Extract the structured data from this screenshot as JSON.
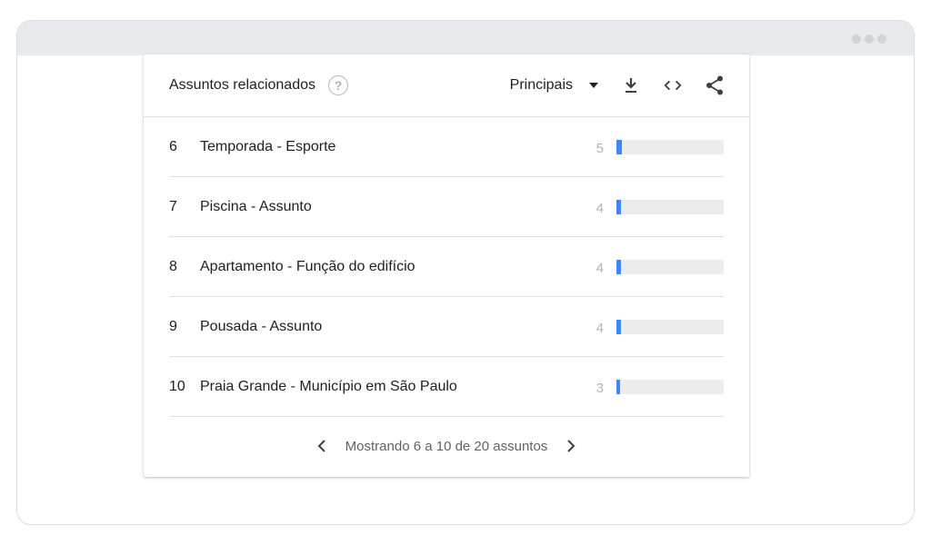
{
  "widget": {
    "title": "Assuntos relacionados",
    "sort_label": "Principais"
  },
  "rows": [
    {
      "rank": "6",
      "label": "Temporada - Esporte",
      "value": "5",
      "fraction": 0.05
    },
    {
      "rank": "7",
      "label": "Piscina - Assunto",
      "value": "4",
      "fraction": 0.04
    },
    {
      "rank": "8",
      "label": "Apartamento - Função do edifício",
      "value": "4",
      "fraction": 0.04
    },
    {
      "rank": "9",
      "label": "Pousada - Assunto",
      "value": "4",
      "fraction": 0.04
    },
    {
      "rank": "10",
      "label": "Praia Grande - Município em São Paulo",
      "value": "3",
      "fraction": 0.03
    }
  ],
  "pager": {
    "text": "Mostrando 6 a 10 de 20 assuntos"
  },
  "colors": {
    "bar": "#4285f4",
    "track": "#ececec"
  },
  "icons": [
    "help-icon",
    "dropdown-caret-icon",
    "download-icon",
    "embed-code-icon",
    "share-icon",
    "chevron-left-icon",
    "chevron-right-icon"
  ]
}
